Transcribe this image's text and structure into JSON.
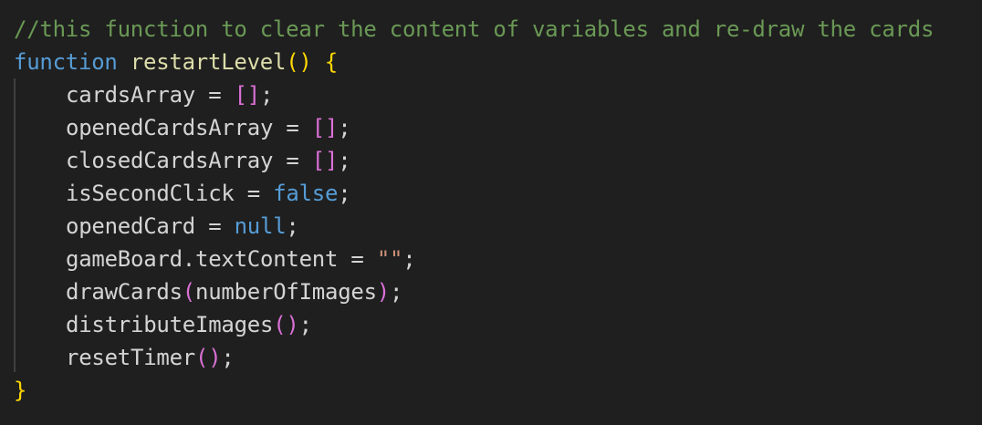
{
  "colors": {
    "background": "#1f1f1f",
    "comment": "#6a9955",
    "keyword": "#569cd6",
    "function": "#dcdcaa",
    "identifier": "#d4d4d4",
    "bracket_level1": "#ffd700",
    "bracket_level2": "#da70d6",
    "literal": "#569cd6",
    "string": "#ce9178",
    "indent_guide": "#404040"
  },
  "code": {
    "lines": [
      {
        "indent": false,
        "tokens": [
          {
            "t": "//this function to clear the content of variables and re-draw the cards",
            "c": "comment"
          }
        ]
      },
      {
        "indent": false,
        "tokens": [
          {
            "t": "function",
            "c": "keyword"
          },
          {
            "t": " ",
            "c": "punc"
          },
          {
            "t": "restartLevel",
            "c": "func"
          },
          {
            "t": "()",
            "c": "paren1"
          },
          {
            "t": " ",
            "c": "punc"
          },
          {
            "t": "{",
            "c": "paren1"
          }
        ]
      },
      {
        "indent": true,
        "tokens": [
          {
            "t": "cardsArray",
            "c": "ident"
          },
          {
            "t": " = ",
            "c": "punc"
          },
          {
            "t": "[]",
            "c": "paren2"
          },
          {
            "t": ";",
            "c": "punc"
          }
        ]
      },
      {
        "indent": true,
        "tokens": [
          {
            "t": "openedCardsArray",
            "c": "ident"
          },
          {
            "t": " = ",
            "c": "punc"
          },
          {
            "t": "[]",
            "c": "paren2"
          },
          {
            "t": ";",
            "c": "punc"
          }
        ]
      },
      {
        "indent": true,
        "tokens": [
          {
            "t": "closedCardsArray",
            "c": "ident"
          },
          {
            "t": " = ",
            "c": "punc"
          },
          {
            "t": "[]",
            "c": "paren2"
          },
          {
            "t": ";",
            "c": "punc"
          }
        ]
      },
      {
        "indent": true,
        "tokens": [
          {
            "t": "isSecondClick",
            "c": "ident"
          },
          {
            "t": " = ",
            "c": "punc"
          },
          {
            "t": "false",
            "c": "literal"
          },
          {
            "t": ";",
            "c": "punc"
          }
        ]
      },
      {
        "indent": true,
        "tokens": [
          {
            "t": "openedCard",
            "c": "ident"
          },
          {
            "t": " = ",
            "c": "punc"
          },
          {
            "t": "null",
            "c": "literal"
          },
          {
            "t": ";",
            "c": "punc"
          }
        ]
      },
      {
        "indent": true,
        "tokens": [
          {
            "t": "gameBoard",
            "c": "ident"
          },
          {
            "t": ".",
            "c": "punc"
          },
          {
            "t": "textContent",
            "c": "ident"
          },
          {
            "t": " = ",
            "c": "punc"
          },
          {
            "t": "\"\"",
            "c": "string"
          },
          {
            "t": ";",
            "c": "punc"
          }
        ]
      },
      {
        "indent": true,
        "tokens": [
          {
            "t": "drawCards",
            "c": "ident"
          },
          {
            "t": "(",
            "c": "paren2"
          },
          {
            "t": "numberOfImages",
            "c": "ident"
          },
          {
            "t": ")",
            "c": "paren2"
          },
          {
            "t": ";",
            "c": "punc"
          }
        ]
      },
      {
        "indent": true,
        "tokens": [
          {
            "t": "distributeImages",
            "c": "ident"
          },
          {
            "t": "()",
            "c": "paren2"
          },
          {
            "t": ";",
            "c": "punc"
          }
        ]
      },
      {
        "indent": true,
        "tokens": [
          {
            "t": "resetTimer",
            "c": "ident"
          },
          {
            "t": "()",
            "c": "paren2"
          },
          {
            "t": ";",
            "c": "punc"
          }
        ]
      },
      {
        "indent": false,
        "tokens": [
          {
            "t": "}",
            "c": "paren1"
          }
        ]
      }
    ]
  }
}
